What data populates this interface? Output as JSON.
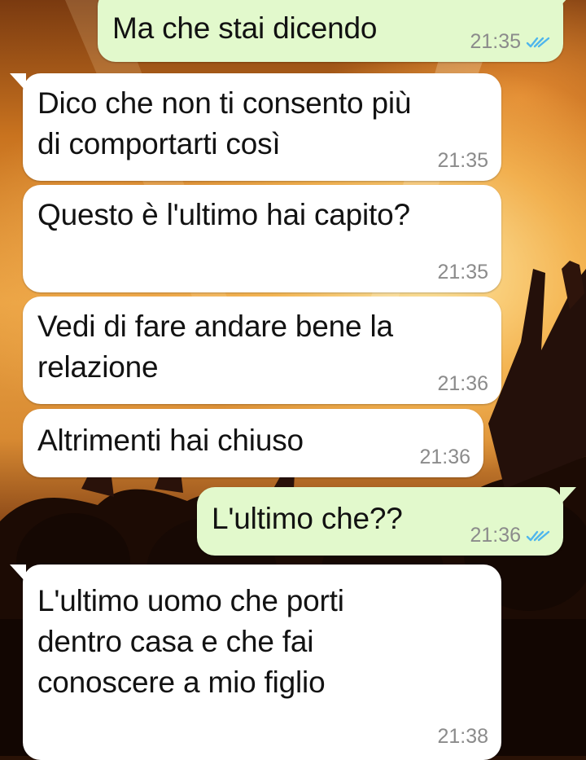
{
  "conversation": {
    "messages": [
      {
        "direction": "outgoing",
        "text": "Ma che stai dicendo",
        "time": "21:35",
        "status_icon": "double-check-read-icon"
      },
      {
        "direction": "incoming",
        "text": "Dico che non ti consento più\ndi comportarti così",
        "time": "21:35"
      },
      {
        "direction": "incoming",
        "text": "Questo è l'ultimo hai capito?",
        "time": "21:35"
      },
      {
        "direction": "incoming",
        "text": "Vedi di fare andare bene la\nrelazione",
        "time": "21:36"
      },
      {
        "direction": "incoming",
        "text": "Altrimenti hai chiuso",
        "time": "21:36"
      },
      {
        "direction": "outgoing",
        "text": "L'ultimo che??",
        "time": "21:36",
        "status_icon": "double-check-read-icon"
      },
      {
        "direction": "incoming",
        "text": "L'ultimo uomo che porti\ndentro casa e che fai\nconoscere a mio figlio",
        "time": "21:38"
      }
    ]
  },
  "colors": {
    "incoming_bubble": "#ffffff",
    "outgoing_bubble": "#e2f9cc",
    "timestamp": "#8b8b8b",
    "read_check": "#4fb6ec",
    "text": "#121212"
  }
}
